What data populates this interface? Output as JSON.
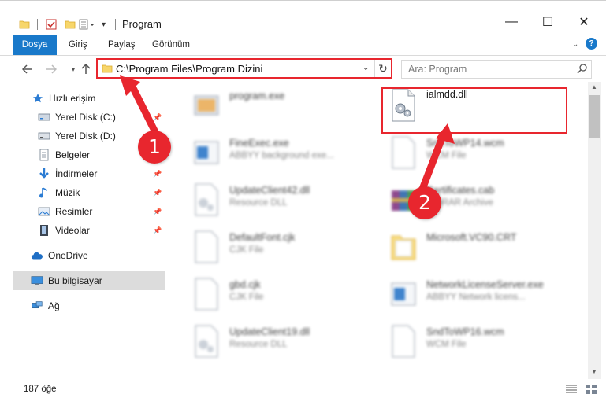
{
  "window": {
    "title": "Program",
    "minimize_glyph": "—",
    "maximize_glyph": "☐",
    "close_glyph": "✕"
  },
  "ribbon": {
    "tabs": [
      {
        "label": "Dosya"
      },
      {
        "label": "Giriş"
      },
      {
        "label": "Paylaş"
      },
      {
        "label": "Görünüm"
      }
    ],
    "help_glyph": "?"
  },
  "address": {
    "path": "C:\\Program Files\\Program Dizini",
    "search_placeholder": "Ara: Program"
  },
  "nav": {
    "items": [
      {
        "label": "Hızlı erişim",
        "icon": "star-icon",
        "pinned": false
      },
      {
        "label": "Yerel Disk (C:)",
        "icon": "drive-icon",
        "pinned": true
      },
      {
        "label": "Yerel Disk (D:)",
        "icon": "drive-icon",
        "pinned": false
      },
      {
        "label": "Belgeler",
        "icon": "documents-icon",
        "pinned": false
      },
      {
        "label": "İndirmeler",
        "icon": "download-icon",
        "pinned": true
      },
      {
        "label": "Müzik",
        "icon": "music-icon",
        "pinned": true
      },
      {
        "label": "Resimler",
        "icon": "pictures-icon",
        "pinned": true
      },
      {
        "label": "Videolar",
        "icon": "videos-icon",
        "pinned": true
      },
      {
        "label": "OneDrive",
        "icon": "cloud-icon",
        "pinned": false
      },
      {
        "label": "Bu bilgisayar",
        "icon": "computer-icon",
        "pinned": false,
        "selected": true
      },
      {
        "label": "Ağ",
        "icon": "network-icon",
        "pinned": false
      }
    ]
  },
  "files": [
    {
      "name": "program.exe",
      "type": "",
      "icon": "exe-icon"
    },
    {
      "name": "ialmdd.dll",
      "type": "",
      "icon": "dll-icon"
    },
    {
      "name": "FineExec.exe",
      "type": "ABBYY background exe...",
      "icon": "exe-icon"
    },
    {
      "name": "SndToWP14.wcm",
      "type": "WCM File",
      "icon": "file-icon"
    },
    {
      "name": "UpdateClient42.dll",
      "type": "Resource DLL",
      "icon": "dll-icon"
    },
    {
      "name": "Certificates.cab",
      "type": "WinRAR Archive",
      "icon": "archive-icon"
    },
    {
      "name": "DefaultFont.cjk",
      "type": "CJK File",
      "icon": "file-icon"
    },
    {
      "name": "Microsoft.VC90.CRT",
      "type": "",
      "icon": "folder-icon"
    },
    {
      "name": "gbd.cjk",
      "type": "CJK File",
      "icon": "file-icon"
    },
    {
      "name": "NetworkLicenseServer.exe",
      "type": "ABBYY Network licens...",
      "icon": "exe-icon"
    },
    {
      "name": "UpdateClient19.dll",
      "type": "Resource DLL",
      "icon": "dll-icon"
    },
    {
      "name": "SndToWP16.wcm",
      "type": "WCM File",
      "icon": "file-icon"
    }
  ],
  "status": {
    "item_count": "187 öğe"
  },
  "annotations": {
    "step1": "1",
    "step2": "2",
    "color": "#e8262e"
  }
}
